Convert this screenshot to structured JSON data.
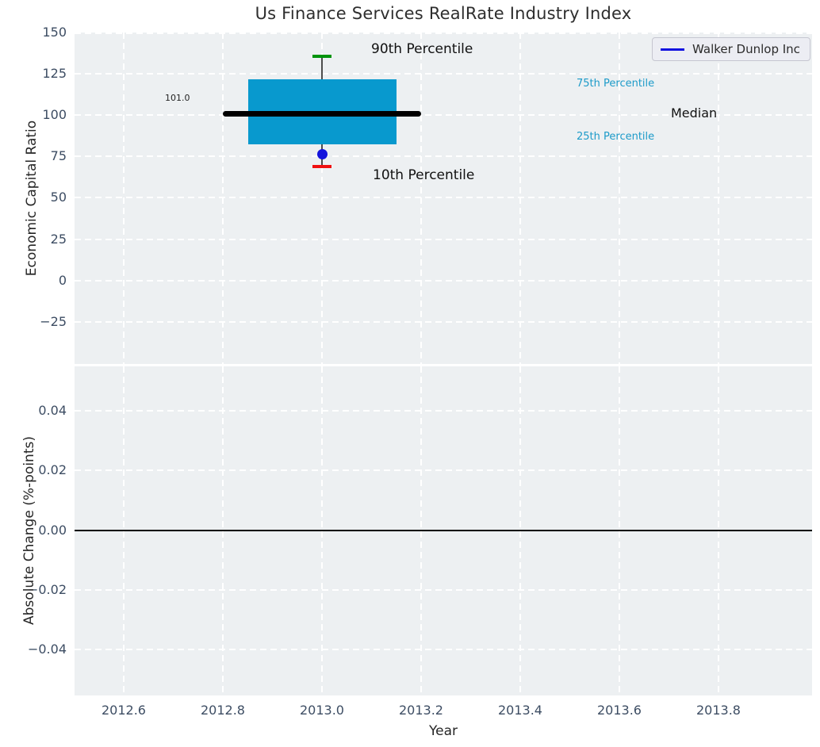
{
  "title": "Us Finance Services RealRate Industry Index",
  "legend": {
    "label": "Walker Dunlop Inc"
  },
  "top_panel": {
    "ylabel": "Economic Capital Ratio",
    "yticks": [
      "150",
      "125",
      "100",
      "75",
      "50",
      "25",
      "0",
      "−25"
    ],
    "annotations": {
      "p90": "90th Percentile",
      "p75": "75th Percentile",
      "median": "Median",
      "p25": "25th Percentile",
      "p10": "10th Percentile",
      "median_value": "101.0"
    }
  },
  "bottom_panel": {
    "ylabel": "Absolute Change (%-points)",
    "yticks": [
      "0.04",
      "0.02",
      "0.00",
      "−0.02",
      "−0.04"
    ]
  },
  "xaxis": {
    "label": "Year",
    "ticks": [
      "2012.6",
      "2012.8",
      "2013.0",
      "2013.2",
      "2013.4",
      "2013.6",
      "2013.8"
    ]
  },
  "chart_data": {
    "type": "box",
    "title": "Us Finance Services RealRate Industry Index",
    "xlabel": "Year",
    "xlim": [
      2012.5,
      2013.99
    ],
    "xticks": [
      2012.6,
      2012.8,
      2013.0,
      2013.2,
      2013.4,
      2013.6,
      2013.8
    ],
    "grid": "white dashed gridlines on light gray background",
    "legend_position": "upper right",
    "panels": [
      {
        "ylabel": "Economic Capital Ratio",
        "ylim": [
          -50.6,
          150
        ],
        "yticks": [
          150,
          125,
          100,
          75,
          50,
          25,
          0,
          -25
        ],
        "series": [
          {
            "name": "Industry distribution box",
            "x": 2013.0,
            "p90": 135.5,
            "p75": 121.5,
            "median": 101.0,
            "p25": 82.5,
            "p10": 68.5,
            "box_x_range": [
              2012.85,
              2013.15
            ],
            "median_x_range": [
              2012.8,
              2013.2
            ],
            "median_label": "101.0"
          },
          {
            "name": "Walker Dunlop Inc",
            "x": 2013.0,
            "value": 76.5,
            "marker": "circle"
          }
        ]
      },
      {
        "ylabel": "Absolute Change (%-points)",
        "ylim": [
          -0.0553,
          0.0548
        ],
        "yticks": [
          0.04,
          0.02,
          0.0,
          -0.02,
          -0.04
        ],
        "series": [],
        "zero_line": 0.0
      }
    ],
    "colors": {
      "box_fill": "#0899ce",
      "median_line": "#000000",
      "p90_cap": "#00930d",
      "p10_cap": "#f01010",
      "company_marker": "#1414dc",
      "legend_line": "#1111e0",
      "percentile_label_text": "#1d9bc9",
      "panel_background": "#edf0f2",
      "tick_label_text": "#3d4d63"
    }
  }
}
